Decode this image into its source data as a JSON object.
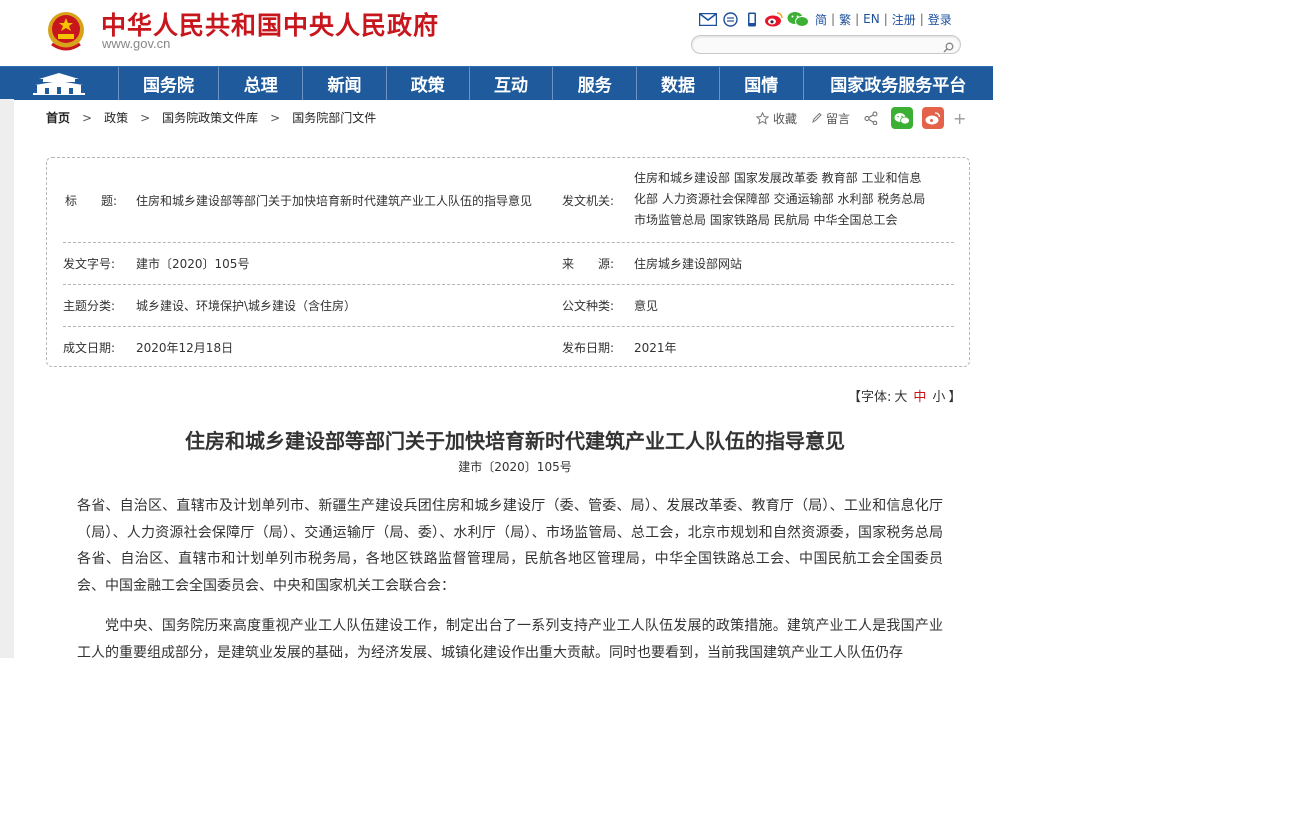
{
  "header": {
    "site_title": "中华人民共和国中央人民政府",
    "site_url": "www.gov.cn",
    "top_links": [
      "简",
      "繁",
      "EN",
      "注册",
      "登录"
    ],
    "top_icons": [
      "mail-icon",
      "message-icon",
      "mobile-icon",
      "weibo-icon",
      "wechat-icon"
    ],
    "search": {
      "placeholder": ""
    }
  },
  "nav": {
    "items": [
      "国务院",
      "总理",
      "新闻",
      "政策",
      "互动",
      "服务",
      "数据",
      "国情",
      "国家政务服务平台"
    ]
  },
  "breadcrumb": [
    "首页",
    "政策",
    "国务院政策文件库",
    "国务院部门文件"
  ],
  "share": {
    "collect": "收藏",
    "comment": "留言"
  },
  "info": {
    "title_label": "标　　题:",
    "title_value": "住房和城乡建设部等部门关于加快培育新时代建筑产业工人队伍的指导意见",
    "issuer_label": "发文机关:",
    "issuer_lines": [
      "住房和城乡建设部 国家发展改革委 教育部 工业和信息",
      "化部 人力资源社会保障部 交通运输部 水利部 税务总局",
      "市场监管总局 国家铁路局 民航局 中华全国总工会"
    ],
    "docno_label": "发文字号:",
    "docno_value": "建市〔2020〕105号",
    "source_label": "来　　源:",
    "source_value": "住房城乡建设部网站",
    "topic_label": "主题分类:",
    "topic_value": "城乡建设、环境保护\\城乡建设（含住房）",
    "type_label": "公文种类:",
    "type_value": "意见",
    "written_label": "成文日期:",
    "written_value": "2020年12月18日",
    "published_label": "发布日期:",
    "published_value": "2021年"
  },
  "fontsize": {
    "prefix": "【字体:",
    "large": "大",
    "medium": "中",
    "small": "小",
    "suffix": "】"
  },
  "article": {
    "title": "住房和城乡建设部等部门关于加快培育新时代建筑产业工人队伍的指导意见",
    "doc_number": "建市〔2020〕105号",
    "paragraphs": [
      "各省、自治区、直辖市及计划单列市、新疆生产建设兵团住房和城乡建设厅（委、管委、局）、发展改革委、教育厅（局）、工业和信息化厅（局）、人力资源社会保障厅（局）、交通运输厅（局、委）、水利厅（局）、市场监管局、总工会，北京市规划和自然资源委，国家税务总局各省、自治区、直辖市和计划单列市税务局，各地区铁路监督管理局，民航各地区管理局，中华全国铁路总工会、中国民航工会全国委员会、中国金融工会全国委员会、中央和国家机关工会联合会：",
      "党中央、国务院历来高度重视产业工人队伍建设工作，制定出台了一系列支持产业工人队伍发展的政策措施。建筑产业工人是我国产业工人的重要组成部分，是建筑业发展的基础，为经济发展、城镇化建设作出重大贡献。同时也要看到，当前我国建筑产业工人队伍仍存"
    ]
  }
}
